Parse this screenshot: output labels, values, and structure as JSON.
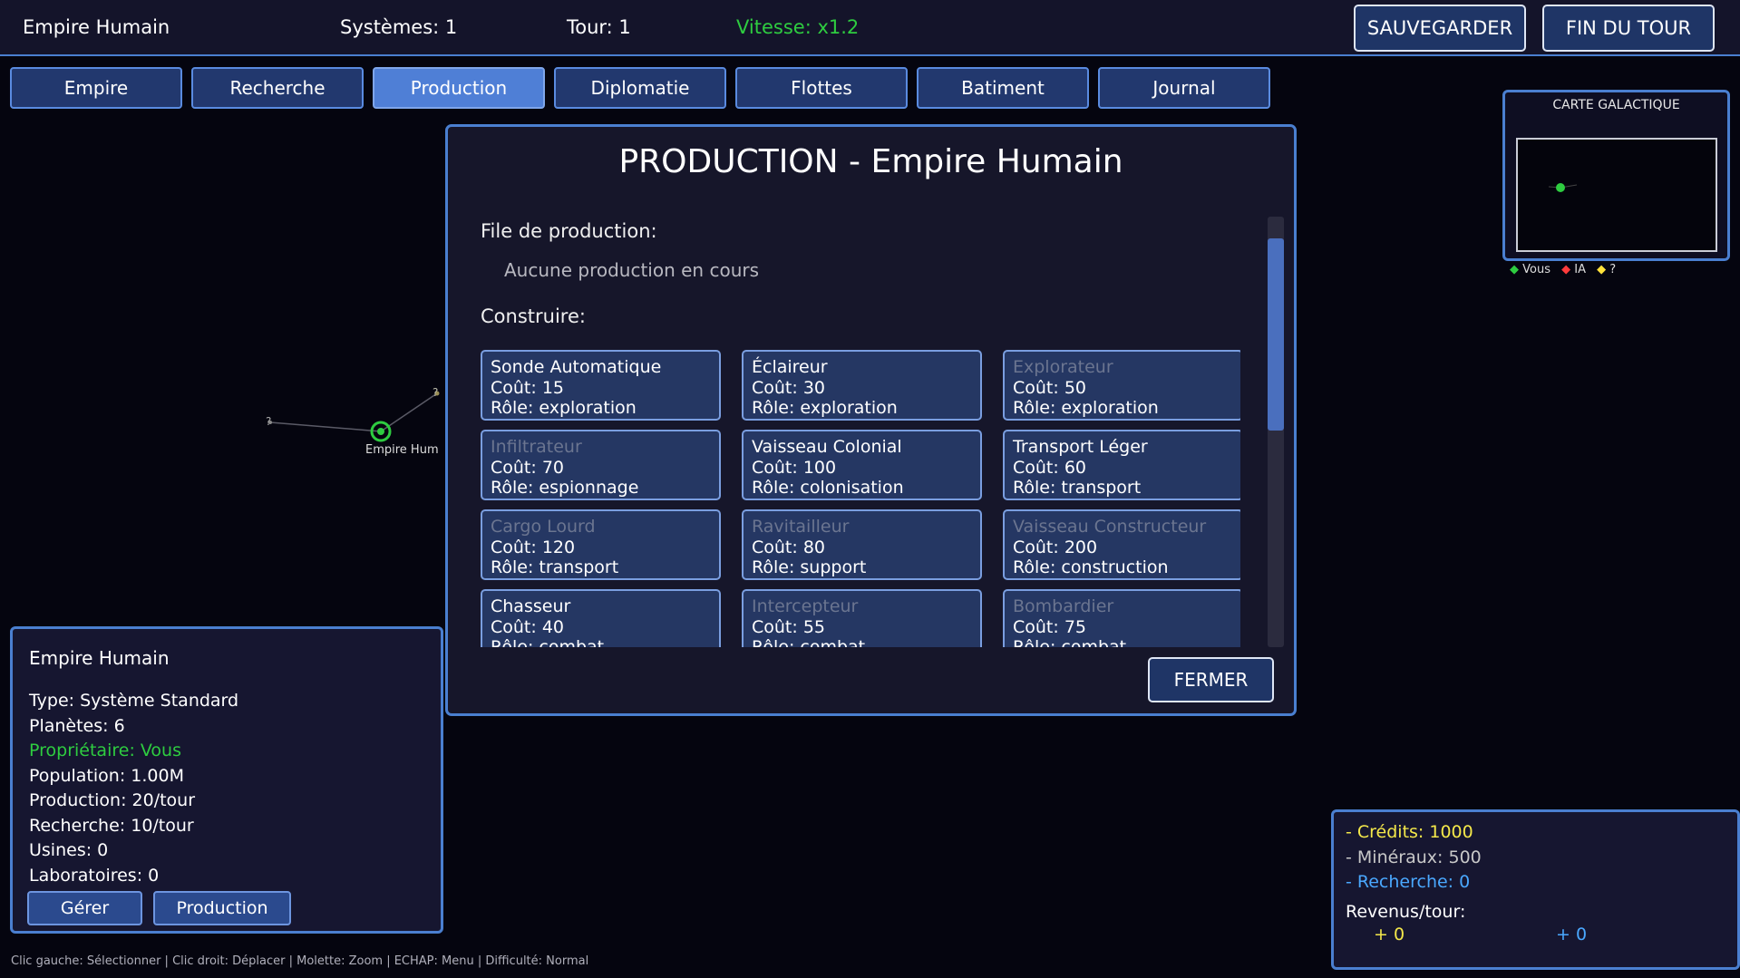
{
  "topbar": {
    "empire_name": "Empire Humain",
    "systems": "Systèmes: 1",
    "turn": "Tour: 1",
    "speed": "Vitesse: x1.2",
    "speed_color": "#2ecc40",
    "save_label": "SAUVEGARDER",
    "end_turn_label": "FIN DU TOUR"
  },
  "tabs": [
    {
      "label": "Empire",
      "active": false
    },
    {
      "label": "Recherche",
      "active": false
    },
    {
      "label": "Production",
      "active": true
    },
    {
      "label": "Diplomatie",
      "active": false
    },
    {
      "label": "Flottes",
      "active": false
    },
    {
      "label": "Batiment",
      "active": false
    },
    {
      "label": "Journal",
      "active": false
    }
  ],
  "minimap": {
    "title": "CARTE GALACTIQUE",
    "legend": [
      {
        "label": "Vous",
        "color": "#2ecc40"
      },
      {
        "label": "IA",
        "color": "#ff3b3b"
      },
      {
        "label": "?",
        "color": "#ffe23b"
      }
    ]
  },
  "map": {
    "home_system_label": "Empire Hum",
    "unknown_marker": "?",
    "home_color": "#2ecc40"
  },
  "dialog": {
    "title": "PRODUCTION - Empire Humain",
    "queue_label": "File de production:",
    "queue_empty": "Aucune production en cours",
    "build_label": "Construire:",
    "close_label": "FERMER",
    "ships": [
      {
        "name": "Sonde Automatique",
        "cost": "Coût: 15",
        "role": "Rôle: exploration",
        "available": true
      },
      {
        "name": "Éclaireur",
        "cost": "Coût: 30",
        "role": "Rôle: exploration",
        "available": true
      },
      {
        "name": "Explorateur",
        "cost": "Coût: 50",
        "role": "Rôle: exploration",
        "available": false
      },
      {
        "name": "Infiltrateur",
        "cost": "Coût: 70",
        "role": "Rôle: espionnage",
        "available": false
      },
      {
        "name": "Vaisseau Colonial",
        "cost": "Coût: 100",
        "role": "Rôle: colonisation",
        "available": true
      },
      {
        "name": "Transport Léger",
        "cost": "Coût: 60",
        "role": "Rôle: transport",
        "available": true
      },
      {
        "name": "Cargo Lourd",
        "cost": "Coût: 120",
        "role": "Rôle: transport",
        "available": false
      },
      {
        "name": "Ravitailleur",
        "cost": "Coût: 80",
        "role": "Rôle: support",
        "available": false
      },
      {
        "name": "Vaisseau Constructeur",
        "cost": "Coût: 200",
        "role": "Rôle: construction",
        "available": false
      },
      {
        "name": "Chasseur",
        "cost": "Coût: 40",
        "role": "Rôle: combat",
        "available": true
      },
      {
        "name": "Intercepteur",
        "cost": "Coût: 55",
        "role": "Rôle: combat",
        "available": false
      },
      {
        "name": "Bombardier",
        "cost": "Coût: 75",
        "role": "Rôle: combat",
        "available": false
      }
    ]
  },
  "system_info": {
    "name": "Empire Humain",
    "type": "Type: Système Standard",
    "planets": "Planètes: 6",
    "owner": "Propriétaire: Vous",
    "owner_color": "#2ecc40",
    "population": "Population: 1.00M",
    "production": "Production: 20/tour",
    "research": "Recherche: 10/tour",
    "factories": "Usines: 0",
    "labs": "Laboratoires: 0",
    "manage_label": "Gérer",
    "production_label": "Production"
  },
  "resources": {
    "credits": "- Crédits: 1000",
    "credits_color": "#f4e84a",
    "minerals": "- Minéraux: 500",
    "minerals_color": "#c8c8c8",
    "research": "- Recherche: 0",
    "research_color": "#4aa8ff",
    "income_label": "Revenus/tour:",
    "income_credits": "+ 0",
    "income_research": "+ 0"
  },
  "footer": "Clic gauche: Sélectionner | Clic droit: Déplacer | Molette: Zoom | ECHAP: Menu | Difficulté: Normal"
}
